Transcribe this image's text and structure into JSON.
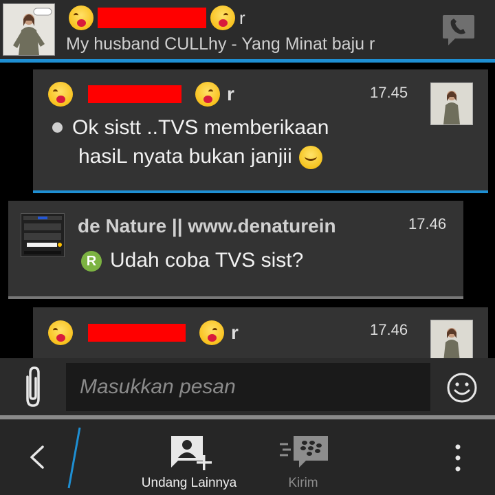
{
  "header": {
    "title_suffix": "r",
    "status": "My husband CULLhy - Yang Minat baju r"
  },
  "messages": [
    {
      "sender_suffix": "r",
      "time": "17.45",
      "text_line1": "Ok sistt ..TVS memberikaan",
      "text_line2": "hasiL nyata bukan janjii"
    },
    {
      "sender": "de Nature || www.denaturein",
      "time": "17.46",
      "badge": "R",
      "text": "Udah coba TVS sist?"
    },
    {
      "sender_suffix": "r",
      "time": "17.46"
    }
  ],
  "composer": {
    "placeholder": "Masukkan pesan"
  },
  "bottom_bar": {
    "invite_label": "Undang Lainnya",
    "send_label": "Kirim"
  },
  "colors": {
    "accent": "#1e8fd3",
    "redaction": "#ff0000",
    "badge": "#7cb342"
  }
}
